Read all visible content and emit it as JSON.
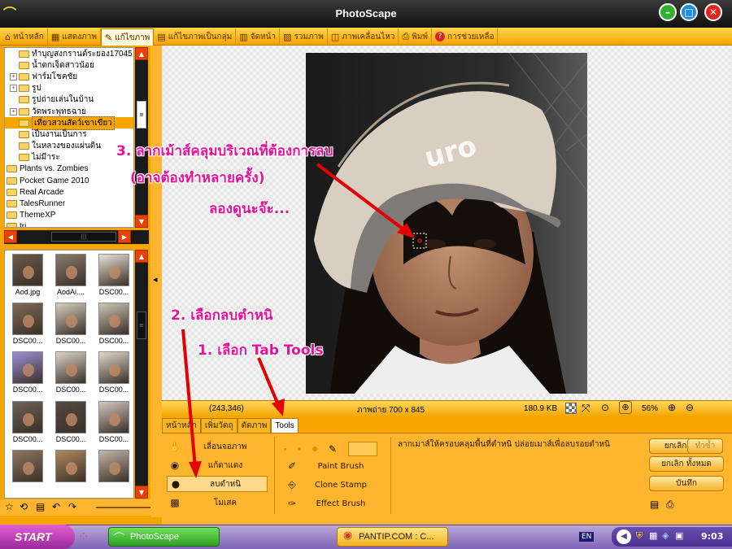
{
  "window": {
    "title": "PhotoScape"
  },
  "tabs": [
    {
      "label": "หน้าหลัก",
      "icon": "home-icon"
    },
    {
      "label": "แสดงภาพ",
      "icon": "viewer-icon"
    },
    {
      "label": "แก้ไขภาพ",
      "icon": "editor-icon",
      "active": true
    },
    {
      "label": "แก้ไขภาพเป็นกลุ่ม",
      "icon": "batch-icon"
    },
    {
      "label": "จัดหน้า",
      "icon": "page-icon"
    },
    {
      "label": "รวมภาพ",
      "icon": "combine-icon"
    },
    {
      "label": "ภาพเคลื่อนไหว",
      "icon": "gif-icon"
    },
    {
      "label": "พิมพ์",
      "icon": "print-icon"
    },
    {
      "label": "การช่วยเหลือ",
      "icon": "help-icon"
    }
  ],
  "tree": {
    "items": [
      {
        "label": "ทำบุญสงกรานต์ระยอง17045",
        "indent": 1,
        "expander": false
      },
      {
        "label": "น้ำตกเจ็ดสาวน้อย",
        "indent": 1,
        "expander": false
      },
      {
        "label": "ฟาร์มโชคชัย",
        "indent": 1,
        "expander": true
      },
      {
        "label": "รูป",
        "indent": 1,
        "expander": true
      },
      {
        "label": "รูปถ่ายเล่นในบ้าน",
        "indent": 1,
        "expander": false
      },
      {
        "label": "วัดพระพุทธฉาย",
        "indent": 1,
        "expander": true
      },
      {
        "label": "เที่ยวสวนสัตว์เขาเขียว",
        "indent": 1,
        "expander": false,
        "selected": true
      },
      {
        "label": "เป็นงานเป็นการ",
        "indent": 1,
        "expander": false
      },
      {
        "label": "ในหลวงของแผ่นดิน",
        "indent": 1,
        "expander": false
      },
      {
        "label": "ไม่มีาระ",
        "indent": 1,
        "expander": false
      },
      {
        "label": "Plants vs. Zombies",
        "indent": 0,
        "expander": false
      },
      {
        "label": "Pocket Game 2010",
        "indent": 0,
        "expander": false
      },
      {
        "label": "Real Arcade",
        "indent": 0,
        "expander": false
      },
      {
        "label": "TalesRunner",
        "indent": 0,
        "expander": false
      },
      {
        "label": "ThemeXP",
        "indent": 0,
        "expander": false
      },
      {
        "label": "tri",
        "indent": 0,
        "expander": false
      }
    ]
  },
  "thumbnails": [
    {
      "caption": "Aod.jpg",
      "color": "#6b5a4a"
    },
    {
      "caption": "AodAi....",
      "color": "#8a7b6d"
    },
    {
      "caption": "DSC00...",
      "color": "#e9e2d6"
    },
    {
      "caption": "DSC00...",
      "color": "#7f6b55"
    },
    {
      "caption": "DSC00...",
      "color": "#d8cfc0"
    },
    {
      "caption": "DSC00...",
      "color": "#cfc6b8"
    },
    {
      "caption": "DSC00...",
      "color": "#9d8fd8"
    },
    {
      "caption": "DSC00...",
      "color": "#ddd6c8"
    },
    {
      "caption": "DSC00...",
      "color": "#e1d9cb"
    },
    {
      "caption": "DSC00...",
      "color": "#6d6155"
    },
    {
      "caption": "DSC00...",
      "color": "#544a40"
    },
    {
      "caption": "DSC00...",
      "color": "#d4c8c0"
    },
    {
      "caption": "",
      "color": "#8d7760"
    },
    {
      "caption": "",
      "color": "#b08a5e"
    },
    {
      "caption": "",
      "color": "#c4b6a6"
    }
  ],
  "status": {
    "coords": "(243,346)",
    "size": "ภาพถ่าย 700 x 845",
    "filesize": "180.9 KB",
    "zoom": "56%"
  },
  "subtabs": [
    "หน้าหลัก",
    "เพิ่มวัตถุ",
    "ตัดภาพ",
    "Tools"
  ],
  "tools": {
    "left": [
      {
        "label": "เลื่อนจอภาพ",
        "icon": "hand-icon"
      },
      {
        "label": "แก้ตาแดง",
        "icon": "eye-icon"
      },
      {
        "label": "ลบตำหนิ",
        "icon": "mole-icon",
        "selected": true
      },
      {
        "label": "โมเสค",
        "icon": "mosaic-icon"
      }
    ],
    "middle": [
      {
        "label": "Paint Brush",
        "icon": "brush-icon"
      },
      {
        "label": "Clone Stamp",
        "icon": "stamp-icon"
      },
      {
        "label": "Effect Brush",
        "icon": "effect-brush-icon"
      }
    ],
    "hint": "ลากเมาส์ให้ครอบคลุมพื้นที่ตำหนิ ปล่อยเมาส์เพื่อลบรอยตำหนิ"
  },
  "buttons": {
    "undo": "ยกเลิก",
    "redo": "ทำซ้ำ",
    "undo_all": "ยกเลิก ทั้งหมด",
    "save": "บันทึก"
  },
  "annotations": {
    "step1": "1. เลือก Tab Tools",
    "step2": "2. เลือกลบตำหนิ",
    "step3": "3. ลากเม้าส์คลุมบริเวณที่ต้องการลบ",
    "step3b": "(อาจต้องทำหลายครั้ง)",
    "step3c": "ลองดูนะจ๊ะ..."
  },
  "taskbar": {
    "start": "START",
    "tasks": [
      "PhotoScape",
      "PANTIP.COM : C..."
    ],
    "lang": "EN",
    "clock": "9:03"
  },
  "colors": {
    "accent": "#f7a600",
    "annotation": "#e8109b",
    "arrow": "#e30000"
  }
}
